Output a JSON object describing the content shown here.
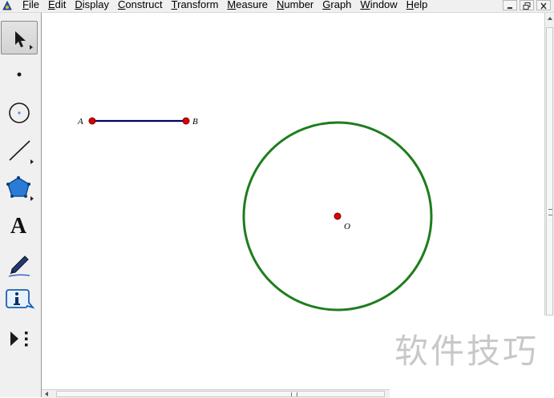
{
  "menubar": {
    "items": [
      {
        "id": "file",
        "label_u": "F",
        "label_rest": "ile"
      },
      {
        "id": "edit",
        "label_u": "E",
        "label_rest": "dit"
      },
      {
        "id": "display",
        "label_u": "D",
        "label_rest": "isplay"
      },
      {
        "id": "construct",
        "label_u": "C",
        "label_rest": "onstruct"
      },
      {
        "id": "transform",
        "label_u": "T",
        "label_rest": "ransform"
      },
      {
        "id": "measure",
        "label_u": "M",
        "label_rest": "easure"
      },
      {
        "id": "number",
        "label_u": "N",
        "label_rest": "umber"
      },
      {
        "id": "graph",
        "label_u": "G",
        "label_rest": "raph"
      },
      {
        "id": "window",
        "label_u": "W",
        "label_rest": "indow"
      },
      {
        "id": "help",
        "label_u": "H",
        "label_rest": "elp"
      }
    ]
  },
  "toolbox": {
    "tools": [
      {
        "id": "selection-arrow",
        "icon": "arrow-icon",
        "active": true
      },
      {
        "id": "point",
        "icon": "point-icon",
        "active": false
      },
      {
        "id": "compass",
        "icon": "circle-icon",
        "active": false
      },
      {
        "id": "straightedge",
        "icon": "segment-icon",
        "active": false
      },
      {
        "id": "polygon",
        "icon": "pentagon-icon",
        "active": false
      },
      {
        "id": "text",
        "icon": "text-icon",
        "label": "A",
        "active": false
      },
      {
        "id": "marker",
        "icon": "marker-pen-icon",
        "active": false
      },
      {
        "id": "information",
        "icon": "info-icon",
        "active": false
      },
      {
        "id": "custom",
        "icon": "custom-tool-icon",
        "active": false
      }
    ]
  },
  "canvas": {
    "points": {
      "A": {
        "label": "A"
      },
      "B": {
        "label": "B"
      },
      "O": {
        "label": "O"
      }
    },
    "colors": {
      "segment": "#000066",
      "circle": "#1e7d1e",
      "point_fill": "#d80000",
      "point_stroke": "#7a0000"
    }
  },
  "watermark": {
    "text": "软件技巧"
  }
}
